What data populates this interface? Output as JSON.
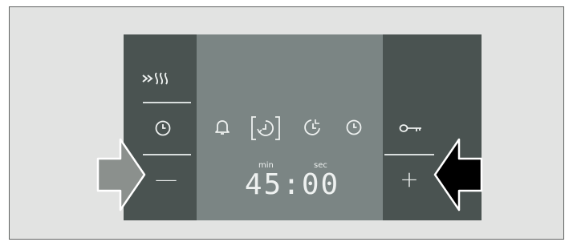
{
  "oven_panel": {
    "colors": {
      "frame_bg": "#e2e3e2",
      "panel_bg": "#4a5351",
      "display_bg": "#7b8584",
      "symbol": "#eef1f0",
      "arrow_left": "#8b908d",
      "arrow_right": "#000000"
    },
    "left_column": {
      "buttons": [
        {
          "name": "rapid-heat-button",
          "icon": "rapid-heat-icon"
        },
        {
          "name": "clock-button",
          "icon": "clock-icon"
        },
        {
          "name": "minus-button",
          "label": "—"
        }
      ]
    },
    "display": {
      "icons": [
        "bell-icon",
        "duration-icon",
        "end-time-icon",
        "clock-icon"
      ],
      "active_icon": "duration-icon",
      "time": "45:00",
      "min_label": "min",
      "sec_label": "sec"
    },
    "right_column": {
      "buttons": [
        {
          "name": "key-button",
          "icon": "key-icon"
        },
        {
          "name": "plus-button",
          "label": "+"
        }
      ]
    },
    "arrows": [
      "left-pointer-arrow",
      "right-pointer-arrow"
    ]
  }
}
